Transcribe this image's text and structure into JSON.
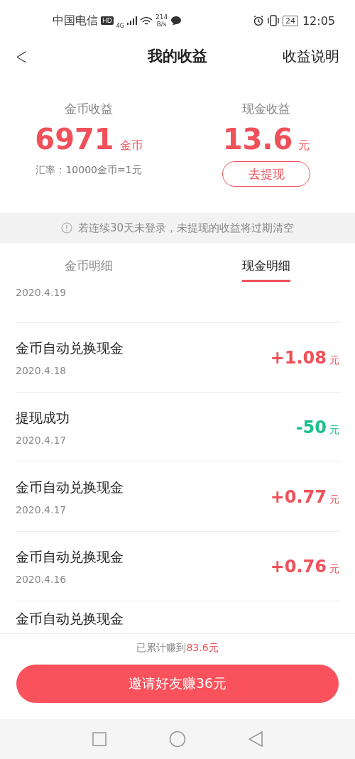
{
  "status_bar": {
    "carrier": "中国电信",
    "hd": "HD",
    "network": "4G",
    "speed_value": "214",
    "speed_unit": "B/s",
    "battery": "24",
    "time": "12:05"
  },
  "header": {
    "back": "<",
    "title": "我的收益",
    "action": "收益说明"
  },
  "summary": {
    "coin": {
      "label": "金币收益",
      "value": "6971",
      "unit": "金币",
      "note": "汇率：10000金币=1元"
    },
    "cash": {
      "label": "现金收益",
      "value": "13.6",
      "unit": "元",
      "button": "去提现"
    }
  },
  "notice": "若连续30天未登录，未提现的收益将过期清空",
  "tabs": [
    {
      "label": "金币明细",
      "selected": false
    },
    {
      "label": "现金明细",
      "selected": true
    }
  ],
  "records": [
    {
      "date": "2020.4.19"
    },
    {
      "title": "金币自动兑换现金",
      "date": "2020.4.18",
      "amount": "+1.08",
      "unit": "元",
      "color": "#f0505a"
    },
    {
      "title": "提现成功",
      "date": "2020.4.17",
      "amount": "-50",
      "unit": "元",
      "color": "#1dbf8e"
    },
    {
      "title": "金币自动兑换现金",
      "date": "2020.4.17",
      "amount": "+0.77",
      "unit": "元",
      "color": "#f0505a"
    },
    {
      "title": "金币自动兑换现金",
      "date": "2020.4.16",
      "amount": "+0.76",
      "unit": "元",
      "color": "#f0505a"
    },
    {
      "title": "金币自动兑换现金"
    }
  ],
  "footer": {
    "total_label": "已累计赚到",
    "total_value": "83.6元",
    "invite_button": "邀请好友赚36元"
  }
}
